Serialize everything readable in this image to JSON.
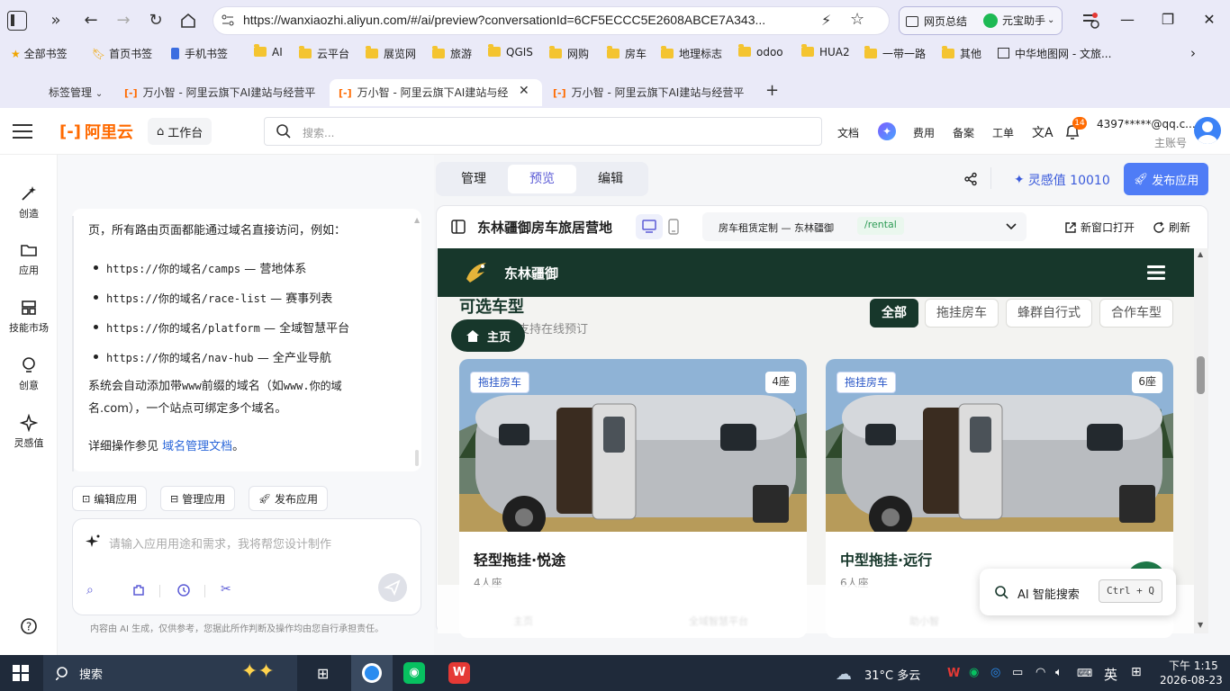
{
  "browser": {
    "url": "https://wanxiaozhi.aliyun.com/#/ai/preview?conversationId=6CF5ECCC5E2608ABCE7A343...",
    "summary_btn": "网页总结",
    "assistant_btn": "元宝助手",
    "bookmarks": [
      "全部书签",
      "首页书签",
      "手机书签",
      "AI",
      "云平台",
      "展览网",
      "旅游",
      "QGIS",
      "网购",
      "房车",
      "地理标志",
      "odoo",
      "HUA2",
      "一带一路",
      "其他",
      "中华地图网 - 文旅..."
    ],
    "tab_manager": "标签管理",
    "tabs": [
      "万小智 - 阿里云旗下AI建站与经营平",
      "万小智 - 阿里云旗下AI建站与经",
      "万小智 - 阿里云旗下AI建站与经营平"
    ]
  },
  "header": {
    "logo": "阿里云",
    "workbench": "工作台",
    "search_placeholder": "搜索...",
    "links": [
      "文档",
      "费用",
      "备案",
      "工单"
    ],
    "notif_count": "14",
    "account": "4397*****@qq.c...",
    "account_sub": "主账号"
  },
  "rail": [
    "创造",
    "应用",
    "技能市场",
    "创意",
    "灵感值"
  ],
  "chat": {
    "intro": "页，所有路由页面都能通过域名直接访问，例如：",
    "bullets": [
      {
        "code": "https://你的域名/camps",
        "desc": " — 营地体系"
      },
      {
        "code": "https://你的域名/race-list",
        "desc": " — 赛事列表"
      },
      {
        "code": "https://你的域名/platform",
        "desc": " — 全域智慧平台"
      },
      {
        "code": "https://你的域名/nav-hub",
        "desc": " — 全产业导航"
      }
    ],
    "note_a": "系统会自动添加带",
    "note_www": "www",
    "note_b": "前缀的域名（如",
    "note_www2": "www.你的域",
    "note_c": "名.com），一个站点可绑定多个域名。",
    "detail_prefix": "详细操作参见 ",
    "detail_link": "域名管理文档",
    "detail_suffix": "。",
    "actions": [
      "编辑应用",
      "管理应用",
      "发布应用"
    ],
    "input_placeholder": "请输入应用用途和需求，我将帮您设计制作",
    "disclaimer": "内容由 AI 生成，仅供参考，您据此所作判断及操作均由您自行承担责任。"
  },
  "preview": {
    "segments": [
      "管理",
      "预览",
      "编辑"
    ],
    "inspiration": "灵感值 10010",
    "publish": "发布应用",
    "site_title": "东林疆御房车旅居营地",
    "page_select": "房车租赁定制 — 东林疆御",
    "route": "/rental",
    "open_new": "新窗口打开",
    "refresh": "刷新"
  },
  "site": {
    "brand": "东林疆御",
    "section_title": "可选车型",
    "section_sub": "实时读取，支持在线预订",
    "home_btn": "主页",
    "filters": [
      "全部",
      "拖挂房车",
      "蜂群自行式",
      "合作车型"
    ],
    "cards": [
      {
        "badge": "拖挂房车",
        "seats": "4座",
        "title": "轻型拖挂·悦途",
        "sub": "4人座"
      },
      {
        "badge": "拖挂房车",
        "seats": "6座",
        "title": "中型拖挂·远行",
        "sub": "6人座"
      }
    ],
    "bottom_nav": [
      "主页",
      "全域智慧平台",
      "助小智"
    ],
    "ai_search": "AI 智能搜索",
    "shortcut": "Ctrl + Q"
  },
  "taskbar": {
    "search": "搜索",
    "weather": "31°C 多云",
    "ime": "英",
    "time": "下午 1:15",
    "date": "2026-08-23"
  },
  "colors": {
    "accent": "#5b5bd6",
    "brand_orange": "#ff6a00",
    "site_green": "#17372b",
    "publish_blue": "#4f7cf6"
  }
}
